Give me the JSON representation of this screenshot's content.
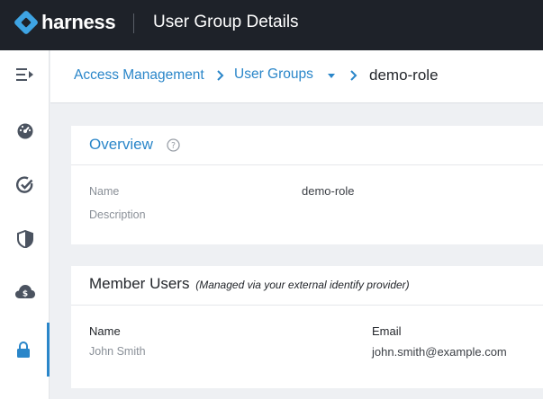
{
  "topbar": {
    "brand": "harness",
    "title": "User Group Details"
  },
  "sidebar": {
    "items": [
      {
        "icon": "collapse-menu-icon"
      },
      {
        "icon": "dashboard-gauge-icon"
      },
      {
        "icon": "verify-check-icon"
      },
      {
        "icon": "shield-icon"
      },
      {
        "icon": "cloud-cost-icon"
      },
      {
        "icon": "lock-icon",
        "active": true
      }
    ]
  },
  "breadcrumb": {
    "items": [
      "Access Management",
      "User Groups"
    ],
    "current": "demo-role"
  },
  "overview": {
    "title": "Overview",
    "name_label": "Name",
    "name_value": "demo-role",
    "description_label": "Description"
  },
  "members": {
    "title": "Member Users",
    "note": "(Managed via your external identify provider)",
    "columns": {
      "name": "Name",
      "email": "Email"
    },
    "rows": [
      {
        "name": "John Smith",
        "email": "john.smith@example.com"
      }
    ]
  },
  "colors": {
    "topbar": "#1e2229",
    "accent": "#2a86c9",
    "logo": "#3ea4e3"
  }
}
